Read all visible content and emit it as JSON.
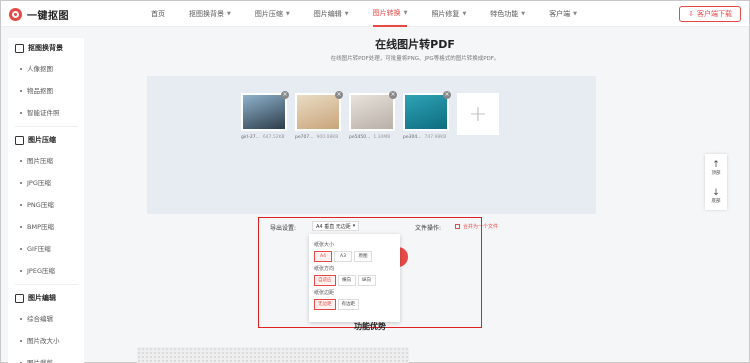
{
  "header": {
    "logo_text": "一键抠图",
    "nav": [
      {
        "label": "首页",
        "has_caret": false,
        "active": false
      },
      {
        "label": "抠图换背景",
        "has_caret": true,
        "active": false
      },
      {
        "label": "图片压缩",
        "has_caret": true,
        "active": false
      },
      {
        "label": "图片编辑",
        "has_caret": true,
        "active": false
      },
      {
        "label": "图片转换",
        "has_caret": true,
        "active": true
      },
      {
        "label": "照片修复",
        "has_caret": true,
        "active": false
      },
      {
        "label": "特色功能",
        "has_caret": true,
        "active": false
      },
      {
        "label": "客户端",
        "has_caret": true,
        "active": false
      }
    ],
    "download_label": "客户端下载",
    "download_icon": "download-icon"
  },
  "sidebar": {
    "groups": [
      {
        "title": "抠图换背景",
        "icon": "crop-icon",
        "items": [
          "人像抠图",
          "物品抠图",
          "智能证件照"
        ]
      },
      {
        "title": "图片压缩",
        "icon": "compress-icon",
        "items": [
          "图片压缩",
          "JPG压缩",
          "PNG压缩",
          "BMP压缩",
          "GIF压缩",
          "JPEG压缩"
        ]
      },
      {
        "title": "图片编辑",
        "icon": "edit-icon",
        "items": [
          "综合编辑",
          "图片改大小",
          "图片裁剪"
        ]
      }
    ]
  },
  "main": {
    "title": "在线图片转PDF",
    "subtitle": "在线图片转PDF处理，可批量将PNG、JPG等格式的图片转换成PDF。",
    "thumbs": [
      {
        "name": "girl-27...",
        "size": "647.52KB",
        "colors": [
          "#8fb3cc",
          "#2d3d4a"
        ]
      },
      {
        "name": "pe707...",
        "size": "900.08KB",
        "colors": [
          "#e9dcc4",
          "#c9a47a"
        ]
      },
      {
        "name": "pe5450...",
        "size": "1.34MB",
        "colors": [
          "#e8e2da",
          "#b8b0a8"
        ]
      },
      {
        "name": "pe304...",
        "size": "747.98KB",
        "colors": [
          "#2fa3b5",
          "#0d6c80"
        ]
      }
    ],
    "add_glyph": "+",
    "export_label": "导出设置:",
    "export_select": "A4 垂直 无边距",
    "file_op_label": "文件操作:",
    "merge_label": "合并为一个文件",
    "dropdown": {
      "paper_label": "纸张大小",
      "paper_opts": [
        {
          "label": "A4",
          "on": true
        },
        {
          "label": "A3",
          "on": false
        },
        {
          "label": "原图",
          "on": false
        }
      ],
      "orient_label": "纸张方向",
      "orient_opts": [
        {
          "label": "自适应",
          "on": true
        },
        {
          "label": "横向",
          "on": false
        },
        {
          "label": "纵向",
          "on": false
        }
      ],
      "margin_label": "纸张边距",
      "margin_opts": [
        {
          "label": "无边距",
          "on": true
        },
        {
          "label": "有边距",
          "on": false
        }
      ]
    },
    "section_title": "功能优势"
  },
  "float_tools": [
    {
      "label": "顶部",
      "glyph": "↑",
      "icon": "to-top-icon"
    },
    {
      "label": "底部",
      "glyph": "↓",
      "icon": "to-bottom-icon"
    }
  ],
  "colors": {
    "accent": "#e74a46",
    "highlight": "#e02020"
  }
}
